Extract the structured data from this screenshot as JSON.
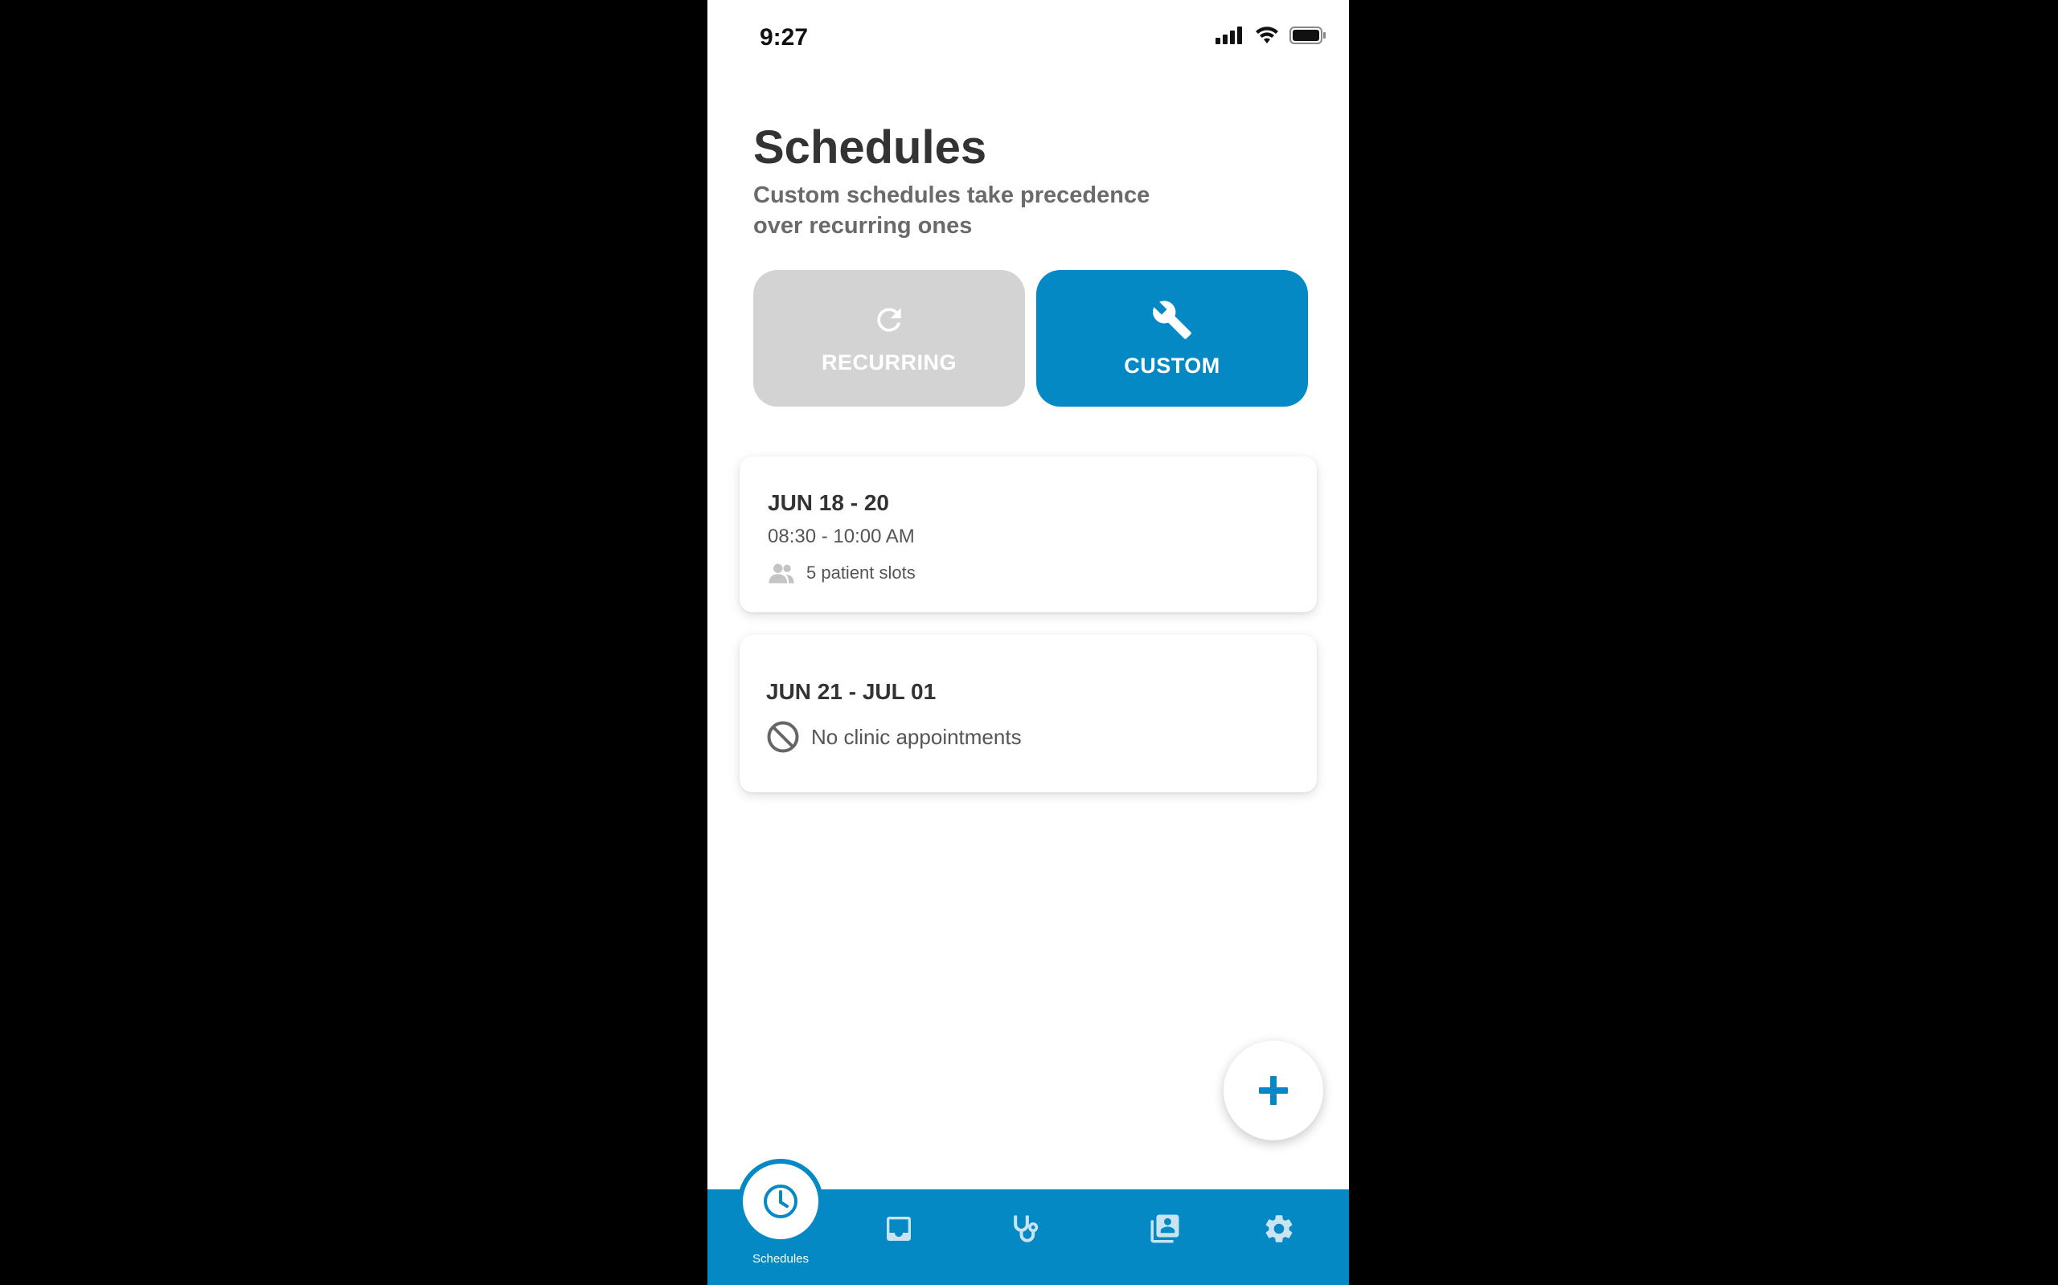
{
  "status_bar": {
    "time": "9:27"
  },
  "header": {
    "title": "Schedules",
    "subtitle": "Custom schedules take precedence over recurring ones"
  },
  "schedule_type_toggle": {
    "recurring_label": "RECURRING",
    "custom_label": "CUSTOM",
    "selected": "CUSTOM"
  },
  "schedules": [
    {
      "date_range": "JUN 18 - 20",
      "time": "08:30 - 10:00 AM",
      "slots": "5 patient slots"
    },
    {
      "date_range": "JUN 21 - JUL 01",
      "status": "No clinic appointments"
    }
  ],
  "bottom_nav": {
    "active_label": "Schedules",
    "items": [
      "schedules-icon",
      "inbox-icon",
      "stethoscope-icon",
      "patients-icon",
      "settings-icon"
    ]
  },
  "colors": {
    "accent": "#0589c4",
    "inactive": "#d3d3d3"
  }
}
